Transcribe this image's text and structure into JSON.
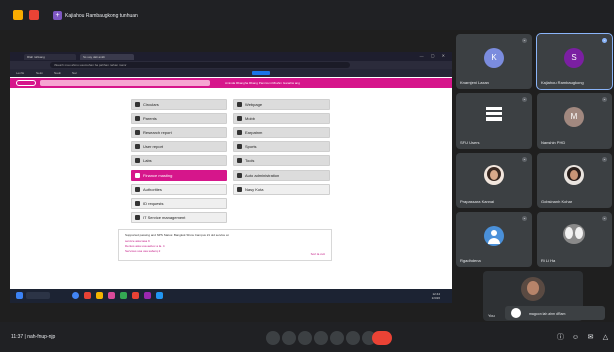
{
  "meeting": {
    "presenter_label": "Kajiahou Rambaugkong tunhuan"
  },
  "browser": {
    "tabs": [
      "Rlah rahkang",
      "Ss uay dali ankb"
    ],
    "window_controls": "— ▢ ✕",
    "address": "thiaunh mau ahmu uaumuhan ba pahhan nahan mamr",
    "bookmarks": [
      "Lenhk",
      "Nekn",
      "Nauli",
      "Nal"
    ],
    "pink_links": "Aminda  Rbangha  Rbang  Pamrcunt  Rbahm  Ganahw  ang"
  },
  "app_tiles": {
    "left": [
      {
        "label": "Circulars",
        "active": false
      },
      {
        "label": "Parents",
        "active": false
      },
      {
        "label": "Research report",
        "active": false
      },
      {
        "label": "User report",
        "active": false
      },
      {
        "label": "Labs",
        "active": false
      },
      {
        "label": "Finance masting",
        "active": true
      },
      {
        "label": "Authorities",
        "active": false
      },
      {
        "label": "ID requests",
        "active": false
      },
      {
        "label": "IT Service management",
        "active": false
      }
    ],
    "right": [
      {
        "label": "Webpage"
      },
      {
        "label": "Mobb"
      },
      {
        "label": "Earpatnm"
      },
      {
        "label": "Sports"
      },
      {
        "label": "Tools"
      },
      {
        "label": "Auto administration"
      },
      {
        "label": "Nasy Kota"
      }
    ]
  },
  "message_box": {
    "lines": [
      "Supported passing and NPS Status: Bangkok Show Campus 21 old service at",
      "service  asia  lasa  9",
      "Dentos asia usa aebox a la.  4",
      "Services usa usa saberq  2"
    ],
    "right_link": "Sort  la cutt"
  },
  "taskbar": {
    "time": "12:44",
    "date": "1/3/26"
  },
  "participants": [
    {
      "initial": "K",
      "name": "Knarnjeni Laxan",
      "color": "#7b8cde"
    },
    {
      "initial": "S",
      "name": "Kajiahou Rambaugkong",
      "color": "#7b1fa2"
    },
    {
      "initial": "",
      "name": "SFU Users",
      "color": ""
    },
    {
      "initial": "M",
      "name": "Nanshin PHD",
      "color": "#a1887f"
    },
    {
      "initial": "",
      "name": "Prapassara Kannai",
      "color": ""
    },
    {
      "initial": "",
      "name": "Gobsinanh Kohar",
      "color": ""
    },
    {
      "initial": "",
      "name": "Rgadhdena",
      "color": ""
    },
    {
      "initial": "",
      "name": "Ri Li Ha",
      "color": ""
    },
    {
      "initial": "",
      "name": "You",
      "color": ""
    },
    {
      "initial": "",
      "name": "magoon lah ahm dRam",
      "color": ""
    }
  ],
  "bottom_bar": {
    "time_label": "11:37  |  nah-fnup-njp"
  }
}
